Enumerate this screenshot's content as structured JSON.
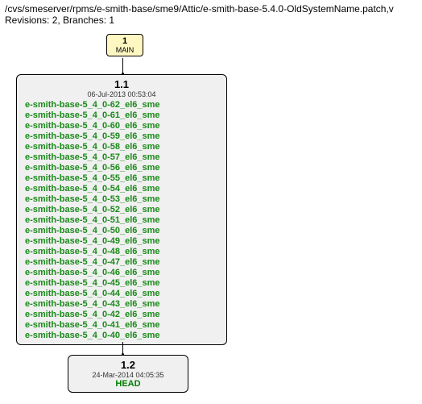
{
  "header": {
    "path": "/cvs/smeserver/rpms/e-smith-base/sme9/Attic/e-smith-base-5.4.0-OldSystemName.patch,v",
    "meta": "Revisions: 2, Branches: 1"
  },
  "main": {
    "number": "1",
    "label": "MAIN"
  },
  "rev1": {
    "version": "1.1",
    "date": "06-Jul-2013 00:53:04",
    "tags": [
      "e-smith-base-5_4_0-62_el6_sme",
      "e-smith-base-5_4_0-61_el6_sme",
      "e-smith-base-5_4_0-60_el6_sme",
      "e-smith-base-5_4_0-59_el6_sme",
      "e-smith-base-5_4_0-58_el6_sme",
      "e-smith-base-5_4_0-57_el6_sme",
      "e-smith-base-5_4_0-56_el6_sme",
      "e-smith-base-5_4_0-55_el6_sme",
      "e-smith-base-5_4_0-54_el6_sme",
      "e-smith-base-5_4_0-53_el6_sme",
      "e-smith-base-5_4_0-52_el6_sme",
      "e-smith-base-5_4_0-51_el6_sme",
      "e-smith-base-5_4_0-50_el6_sme",
      "e-smith-base-5_4_0-49_el6_sme",
      "e-smith-base-5_4_0-48_el6_sme",
      "e-smith-base-5_4_0-47_el6_sme",
      "e-smith-base-5_4_0-46_el6_sme",
      "e-smith-base-5_4_0-45_el6_sme",
      "e-smith-base-5_4_0-44_el6_sme",
      "e-smith-base-5_4_0-43_el6_sme",
      "e-smith-base-5_4_0-42_el6_sme",
      "e-smith-base-5_4_0-41_el6_sme",
      "e-smith-base-5_4_0-40_el6_sme"
    ]
  },
  "rev2": {
    "version": "1.2",
    "date": "24-Mar-2014 04:05:35",
    "head": "HEAD"
  }
}
